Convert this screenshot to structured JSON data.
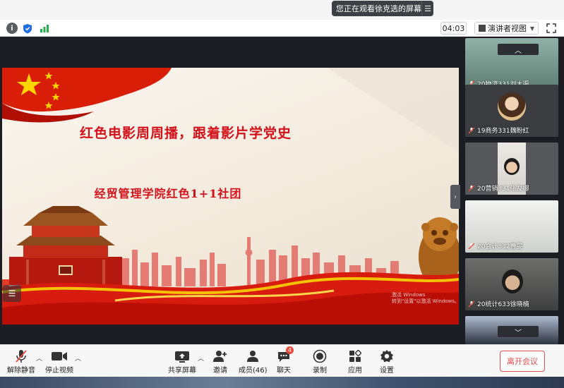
{
  "share_banner": {
    "text": "您正在观看徐克选的屏幕",
    "menu_icon": "menu-icon"
  },
  "toolbar": {
    "timer": "04:03",
    "view_mode": "演讲者视图"
  },
  "slide": {
    "title": "红色电影周周播，跟着影片学党史",
    "subtitle": "经贸管理学院红色1+1社团",
    "watermark_line1": "激活 Windows",
    "watermark_line2": "转到\"设置\"以激活 Windows。"
  },
  "participants": [
    {
      "name": "20物流331刘大渠",
      "tile_color": "#6b8a80"
    },
    {
      "name": "19商务331魏盼红",
      "tile_color": "#3a3c40"
    },
    {
      "name": "20营销331张友娜",
      "tile_color": "#55575a"
    },
    {
      "name": "20会计332曹雯",
      "tile_color": "#d9d9d6"
    },
    {
      "name": "20统计633徐晓楠",
      "tile_color": "#4a4b4c"
    },
    {
      "name": "",
      "tile_color": "#2e3440"
    }
  ],
  "bottombar": {
    "unmute": "解除静音",
    "stop_video": "停止视频",
    "share_screen": "共享屏幕",
    "invite": "邀请",
    "members": "成员(46)",
    "chat": "聊天",
    "chat_badge": "4",
    "record": "录制",
    "apps": "应用",
    "settings": "设置",
    "leave": "离开会议"
  }
}
